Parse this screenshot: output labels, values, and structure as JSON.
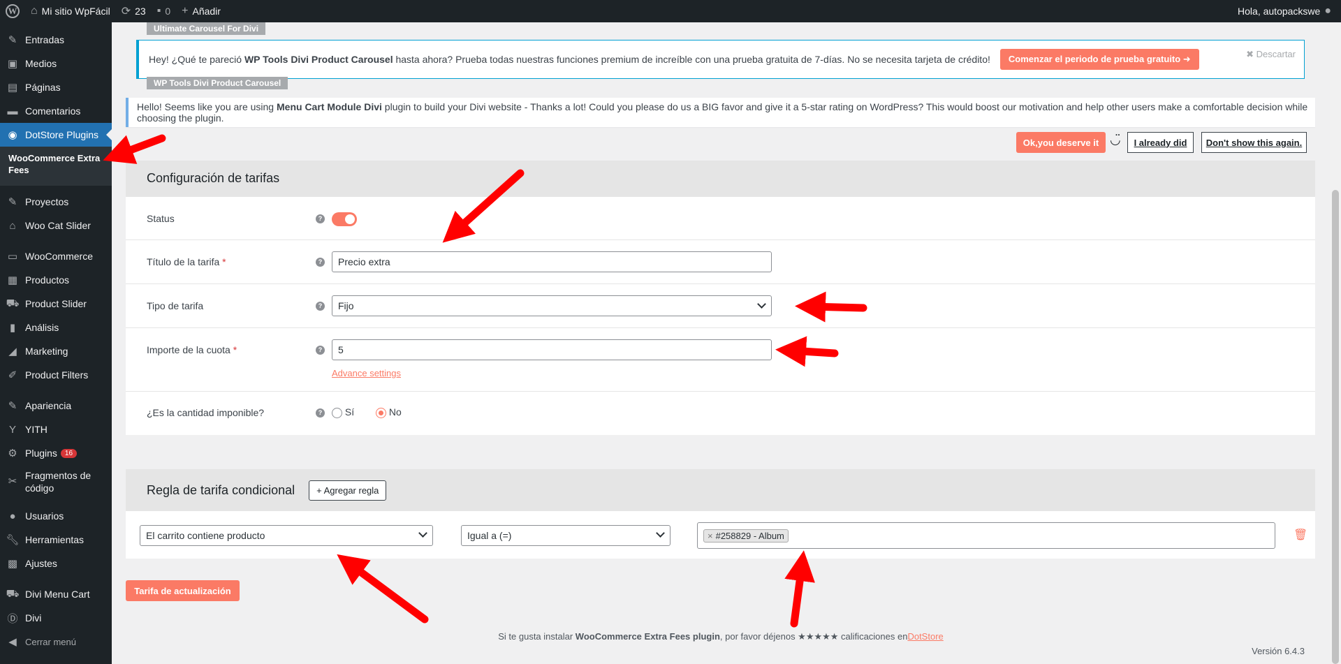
{
  "adminbar": {
    "site_name": "Mi sitio WpFácil",
    "updates_count": "23",
    "comments_count": "0",
    "add_label": "Añadir",
    "greeting": "Hola, autopackswe"
  },
  "sidebar": {
    "items": [
      {
        "label": "Entradas",
        "icon": "pin-icon"
      },
      {
        "label": "Medios",
        "icon": "media-icon"
      },
      {
        "label": "Páginas",
        "icon": "pages-icon"
      },
      {
        "label": "Comentarios",
        "icon": "comments-icon"
      },
      {
        "label": "DotStore Plugins",
        "icon": "dotstore-icon"
      },
      {
        "label": "Proyectos",
        "icon": "pin-icon"
      },
      {
        "label": "Woo Cat Slider",
        "icon": "basket-icon"
      },
      {
        "label": "WooCommerce",
        "icon": "woo-icon"
      },
      {
        "label": "Productos",
        "icon": "box-icon"
      },
      {
        "label": "Product Slider",
        "icon": "cart-icon"
      },
      {
        "label": "Análisis",
        "icon": "chart-icon"
      },
      {
        "label": "Marketing",
        "icon": "megaphone-icon"
      },
      {
        "label": "Product Filters",
        "icon": "edit-icon"
      },
      {
        "label": "Apariencia",
        "icon": "brush-icon"
      },
      {
        "label": "YITH",
        "icon": "yith-icon"
      },
      {
        "label": "Plugins",
        "icon": "plugin-icon",
        "badge": "16"
      },
      {
        "label": "Fragmentos de código",
        "icon": "scissors-icon"
      },
      {
        "label": "Usuarios",
        "icon": "user-icon"
      },
      {
        "label": "Herramientas",
        "icon": "wrench-icon"
      },
      {
        "label": "Ajustes",
        "icon": "settings-icon"
      },
      {
        "label": "Divi Menu Cart",
        "icon": "cart-icon"
      },
      {
        "label": "Divi",
        "icon": "divi-icon"
      }
    ],
    "submenu_active": "WooCommerce Extra Fees",
    "collapse_label": "Cerrar menú"
  },
  "notices": {
    "tag1": "Ultimate Carousel For Divi",
    "trial_text_pre": "Hey! ¿Qué te pareció ",
    "trial_text_bold": "WP Tools Divi Product Carousel",
    "trial_text_post": " hasta ahora? Prueba todas nuestras funciones premium de increíble con una prueba gratuita de 7-días. No se necesita tarjeta de crédito!",
    "trial_button": "Comenzar el periodo de prueba gratuito  ➜",
    "dismiss_label": "Descartar",
    "tag2": "WP Tools Divi Product Carousel",
    "rate_pre": "Hello! Seems like you are using ",
    "rate_bold": "Menu Cart Module Divi",
    "rate_post": " plugin to build your Divi website - Thanks a lot! Could you please do us a BIG favor and give it a 5-star rating on WordPress? This would boost our motivation and help other users make a comfortable decision while choosing the plugin.",
    "btn_deserve": "Ok,you deserve it",
    "btn_already": "I already did",
    "btn_dont_show": "Don't show this again."
  },
  "fee_config": {
    "title": "Configuración de tarifas",
    "status_label": "Status",
    "title_label": "Título de la tarifa",
    "title_value": "Precio extra",
    "type_label": "Tipo de tarifa",
    "type_value": "Fijo",
    "amount_label": "Importe de la cuota",
    "amount_value": "5",
    "advance_link": "Advance settings",
    "taxable_label": "¿Es la cantidad imponible?",
    "taxable_yes": "Sí",
    "taxable_no": "No",
    "required_mark": "*",
    "help_mark": "?"
  },
  "conditional": {
    "title": "Regla de tarifa condicional",
    "add_rule_button": "+ Agregar regla",
    "condition_value": "El carrito contiene producto",
    "operator_value": "Igual a (=)",
    "product_chip": "#258829 - Album",
    "chip_remove": "×"
  },
  "submit_button": "Tarifa de actualización",
  "footer": {
    "text_pre": "Si te gusta instalar ",
    "text_bold": "WooCommerce Extra Fees plugin",
    "text_mid": ", por favor déjenos ★★★★★ calificaciones en",
    "link": "DotStore",
    "version": "Versión 6.4.3"
  },
  "colors": {
    "accent": "#fb7a65",
    "admin_dark": "#1d2327",
    "wp_blue": "#2271b1",
    "arrow_red": "#ff0000"
  }
}
